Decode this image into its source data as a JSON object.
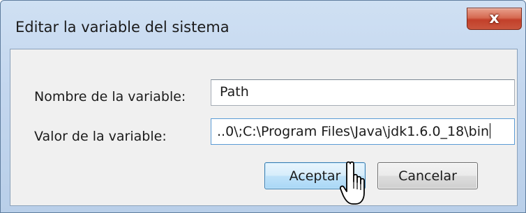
{
  "dialog": {
    "title": "Editar la variable del sistema",
    "close_label": "x"
  },
  "form": {
    "name_label": "Nombre de la variable:",
    "name_value": "Path",
    "value_label": "Valor de la variable:",
    "value_value": "..0\\;C:\\Program Files\\Java\\jdk1.6.0_18\\bin"
  },
  "buttons": {
    "ok_label": "Aceptar",
    "cancel_label": "Cancelar"
  },
  "icons": {
    "cursor": "hand-pointer-icon",
    "close": "close-icon"
  },
  "colors": {
    "title_bar": "#c3d6ee",
    "close_button": "#c9553d",
    "default_button": "#bfe2f9",
    "content_bg": "#f0f0f0"
  }
}
